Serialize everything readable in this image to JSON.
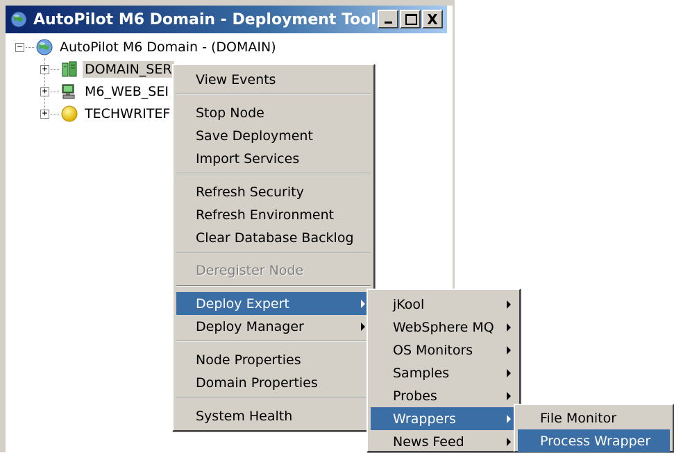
{
  "window": {
    "title": "AutoPilot M6 Domain - Deployment Tool",
    "buttons": {
      "minimize": "_",
      "maximize": "□",
      "close": "X"
    }
  },
  "tree": {
    "root": {
      "label": "AutoPilot M6 Domain - (DOMAIN)",
      "icon": "globe-icon",
      "expander": "−"
    },
    "children": [
      {
        "label": "DOMAIN_SER",
        "icon": "server-icon",
        "expander": "+"
      },
      {
        "label": "M6_WEB_SEI",
        "icon": "computer-icon",
        "expander": "+"
      },
      {
        "label": "TECHWRITEF",
        "icon": "yellow-node-icon",
        "expander": "+"
      }
    ]
  },
  "context_menu": {
    "items": [
      "View Events",
      "Stop Node",
      "Save Deployment",
      "Import Services",
      "Refresh Security",
      "Refresh Environment",
      "Clear Database Backlog",
      "Deregister Node",
      "Deploy Expert",
      "Deploy Manager",
      "Node Properties",
      "Domain Properties",
      "System Health"
    ]
  },
  "submenu_expert": {
    "items": [
      "jKool",
      "WebSphere MQ",
      "OS Monitors",
      "Samples",
      "Probes",
      "Wrappers",
      "News Feed"
    ]
  },
  "submenu_wrappers": {
    "items": [
      "File Monitor",
      "Process Wrapper"
    ]
  },
  "colors": {
    "highlight": "#3a6ea5",
    "menu_bg": "#d4d0c8",
    "title_start": "#0a246a"
  }
}
